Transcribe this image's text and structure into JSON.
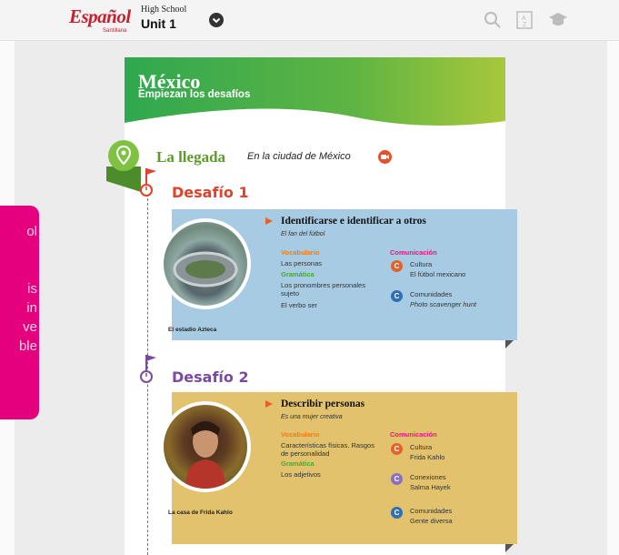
{
  "header": {
    "logo_text": "Español",
    "logo_sub": "Santillana",
    "level": "High School",
    "unit": "Unit 1",
    "icons": [
      "chevron-down-icon",
      "search-icon",
      "glossary-icon",
      "graduation-cap-icon"
    ]
  },
  "tooltip": {
    "lines": [
      "ol",
      "",
      "is",
      "in",
      "ve",
      "ble"
    ]
  },
  "page": {
    "title": "México",
    "subtitle": "Empiezan los desafíos",
    "section_title": "La llegada",
    "section_subtitle": "En la ciudad de México",
    "desafios": [
      {
        "title": "Desafío 1",
        "heading": "Identificarse e identificar a otros",
        "italic": "El fan del fútbol",
        "photo_caption": "El estadio Azteca",
        "vocab_label": "Vocabulario",
        "vocab_items": [
          "Las personas"
        ],
        "gram_label": "Gramática",
        "gram_items": [
          "Los pronombres personales sujeto",
          "El verbo ser"
        ],
        "comm_label": "Comunicación",
        "comm_items": [
          {
            "label": "Cultura",
            "value": "El fútbol mexicano",
            "italic": false
          },
          {
            "label": "Comunidades",
            "value": "Photo scavenger hunt",
            "italic": true
          }
        ]
      },
      {
        "title": "Desafío 2",
        "heading": "Describir personas",
        "italic": "Es una mujer creativa",
        "photo_caption": "La casa de Frida Kahlo",
        "vocab_label": "Vocabulario",
        "vocab_items": [
          "Características físicas. Rasgos de personalidad"
        ],
        "gram_label": "Gramática",
        "gram_items": [
          "Los adjetivos"
        ],
        "comm_label": "Comunicación",
        "comm_items": [
          {
            "label": "Cultura",
            "value": "Frida Kahlo",
            "italic": false
          },
          {
            "label": "Conexiones",
            "value": "Salma Hayek",
            "italic": false
          },
          {
            "label": "Comunidades",
            "value": "Gente diversa",
            "italic": false
          }
        ]
      }
    ]
  },
  "colors": {
    "brand_red": "#c8202e",
    "tooltip_pink": "#e5007e",
    "section_green": "#5c9a2b",
    "desafio_1": "#e4402a",
    "desafio_2": "#7a4aa0",
    "card_1_bg": "#a7cbe2",
    "card_2_bg": "#e2c26d",
    "vocab_orange": "#ef7d1a",
    "gram_green": "#4aa832",
    "comm_magenta": "#e2177e"
  }
}
